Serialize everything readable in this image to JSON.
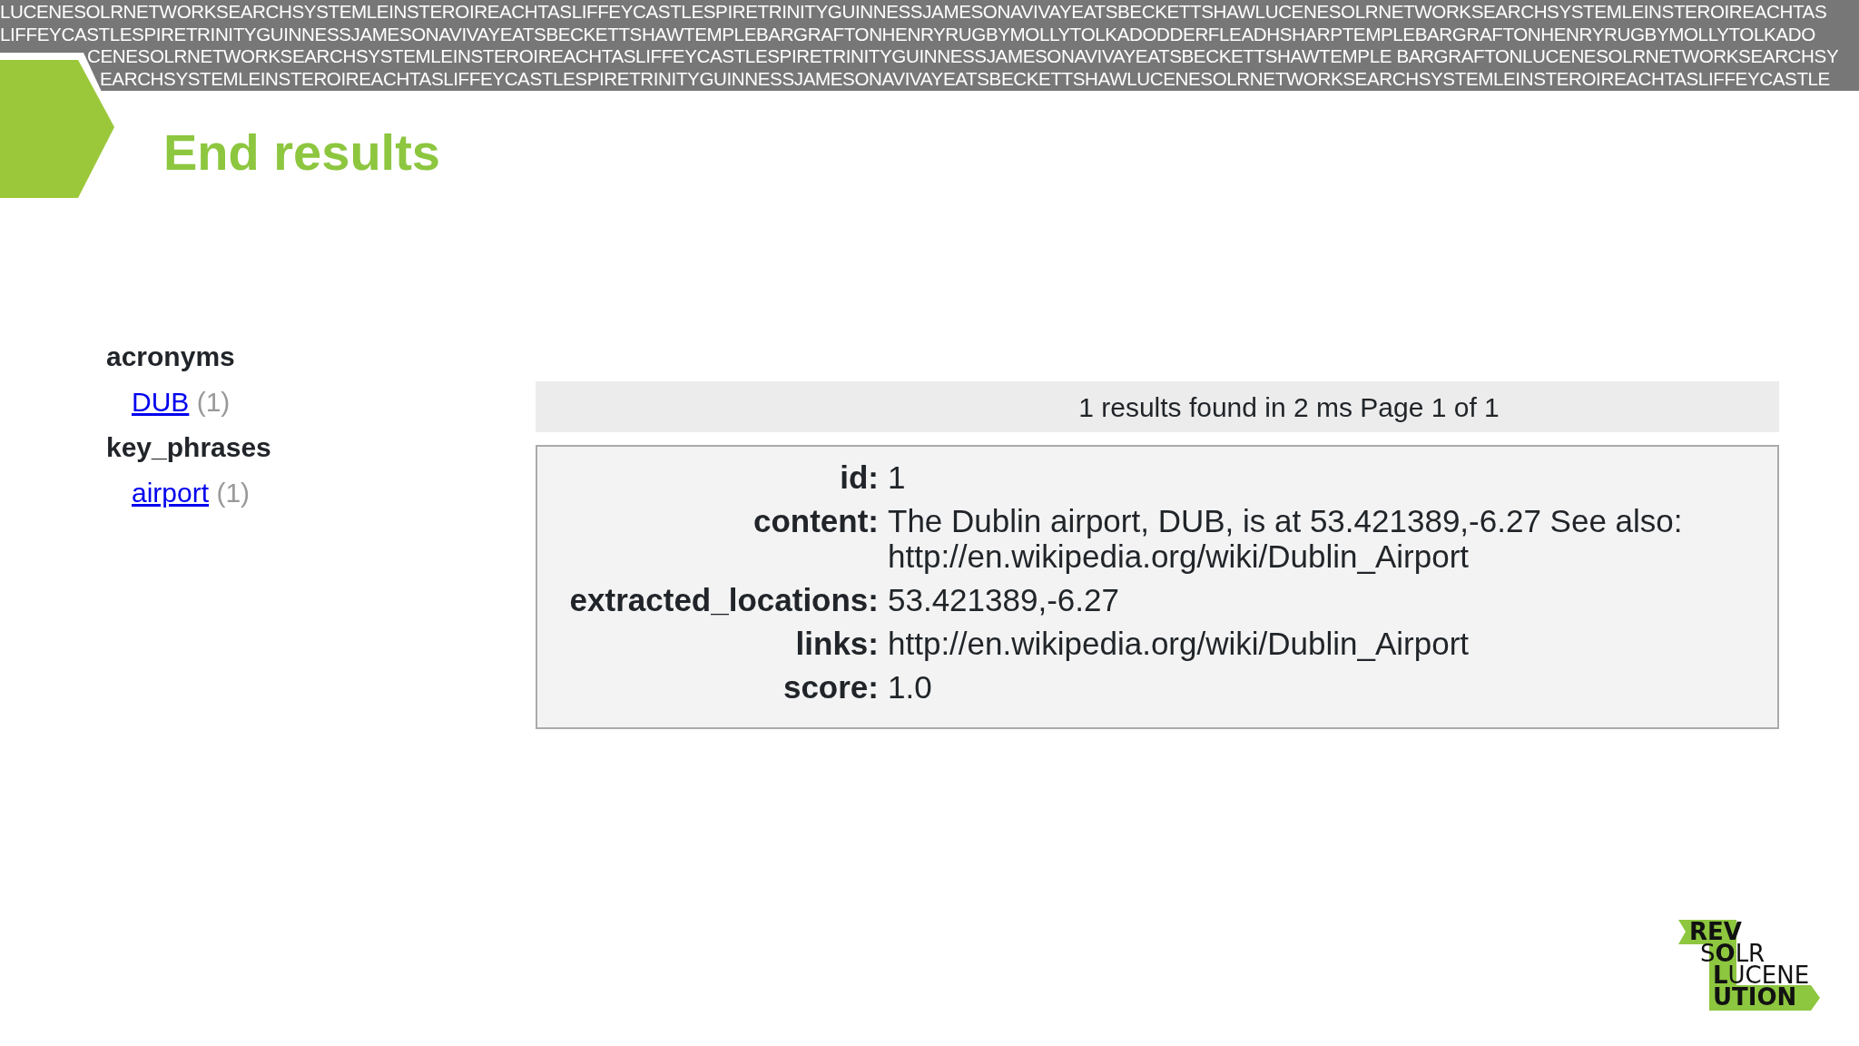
{
  "banner_lines": [
    "LUCENESOLRNETWORKSEARCHSYSTEMLEINSTEROIREACHTASLIFFEYCASTLESPIRETRINITYGUINNESSJAMESONAVIVAYEATSBECKETTSHAWLUCENESOLRNETWORKSEARCHSYSTEMLEINSTEROIREACHTAS",
    "LIFFEYCASTLESPIRETRINITYGUINNESSJAMESONAVIVAYEATSBECKETTSHAWTEMPLEBARGRAFTONHENRYRUGBYMOLLYTOLKADODDERFLEADHSHARPTEMPLEBARGRAFTONHENRYRUGBYMOLLYTOLKADO",
    "CENESOLRNETWORKSEARCHSYSTEMLEINSTEROIREACHTASLIFFEYCASTLESPIRETRINITYGUINNESSJAMESONAVIVAYEATSBECKETTSHAWTEMPLE BARGRAFTONLUCENESOLRNETWORKSEARCHSY",
    "EARCHSYSTEMLEINSTEROIREACHTASLIFFEYCASTLESPIRETRINITYGUINNESSJAMESONAVIVAYEATSBECKETTSHAWLUCENESOLRNETWORKSEARCHSYSTEMLEINSTEROIREACHTASLIFFEYCASTLE"
  ],
  "title": "End results",
  "facets": [
    {
      "name": "acronyms",
      "values": [
        {
          "label": "DUB",
          "count": "(1)"
        }
      ]
    },
    {
      "name": "key_phrases",
      "values": [
        {
          "label": "airport",
          "count": "(1)"
        }
      ]
    }
  ],
  "results_header": "1 results found in 2 ms Page 1 of 1",
  "result_fields": [
    {
      "label": "id:",
      "value": "1"
    },
    {
      "label": "content:",
      "value": "The Dublin airport, DUB, is at 53.421389,-6.27 See also: http://en.wikipedia.org/wiki/Dublin_Airport"
    },
    {
      "label": "extracted_locations:",
      "value": "53.421389,-6.27"
    },
    {
      "label": "links:",
      "value": "http://en.wikipedia.org/wiki/Dublin_Airport"
    },
    {
      "label": "score:",
      "value": "1.0"
    }
  ],
  "logo_lines": [
    {
      "text": "REV",
      "bold": true
    },
    {
      "text": "S**O**LR",
      "bold": false
    },
    {
      "text": "**L**UCENE",
      "bold": false
    },
    {
      "text": "UTION",
      "bold": true
    }
  ]
}
